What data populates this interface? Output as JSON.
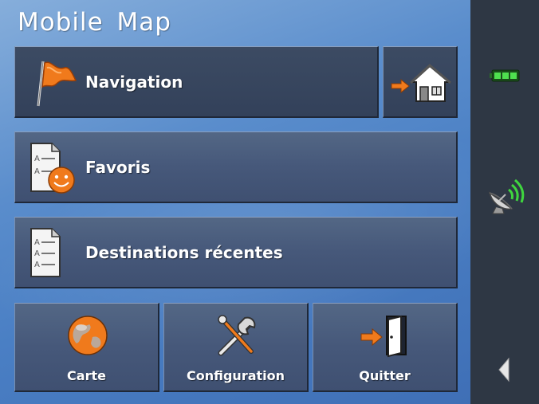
{
  "app": {
    "title": "Mobile Map"
  },
  "menu": {
    "navigation": {
      "label": "Navigation",
      "icon": "flag-icon"
    },
    "home": {
      "icon": "home-icon"
    },
    "favorites": {
      "label": "Favoris",
      "icon": "favorites-icon"
    },
    "recent": {
      "label": "Destinations récentes",
      "icon": "recent-destinations-icon"
    },
    "map": {
      "label": "Carte",
      "icon": "globe-icon"
    },
    "settings": {
      "label": "Configuration",
      "icon": "tools-icon"
    },
    "quit": {
      "label": "Quitter",
      "icon": "exit-door-icon"
    }
  },
  "status": {
    "battery_icon": "battery-icon",
    "gps_icon": "satellite-dish-icon",
    "back_icon": "back-arrow-icon"
  },
  "colors": {
    "accent_orange": "#f07a1c",
    "battery_green": "#3ec43e",
    "signal_green": "#3fd63f"
  }
}
